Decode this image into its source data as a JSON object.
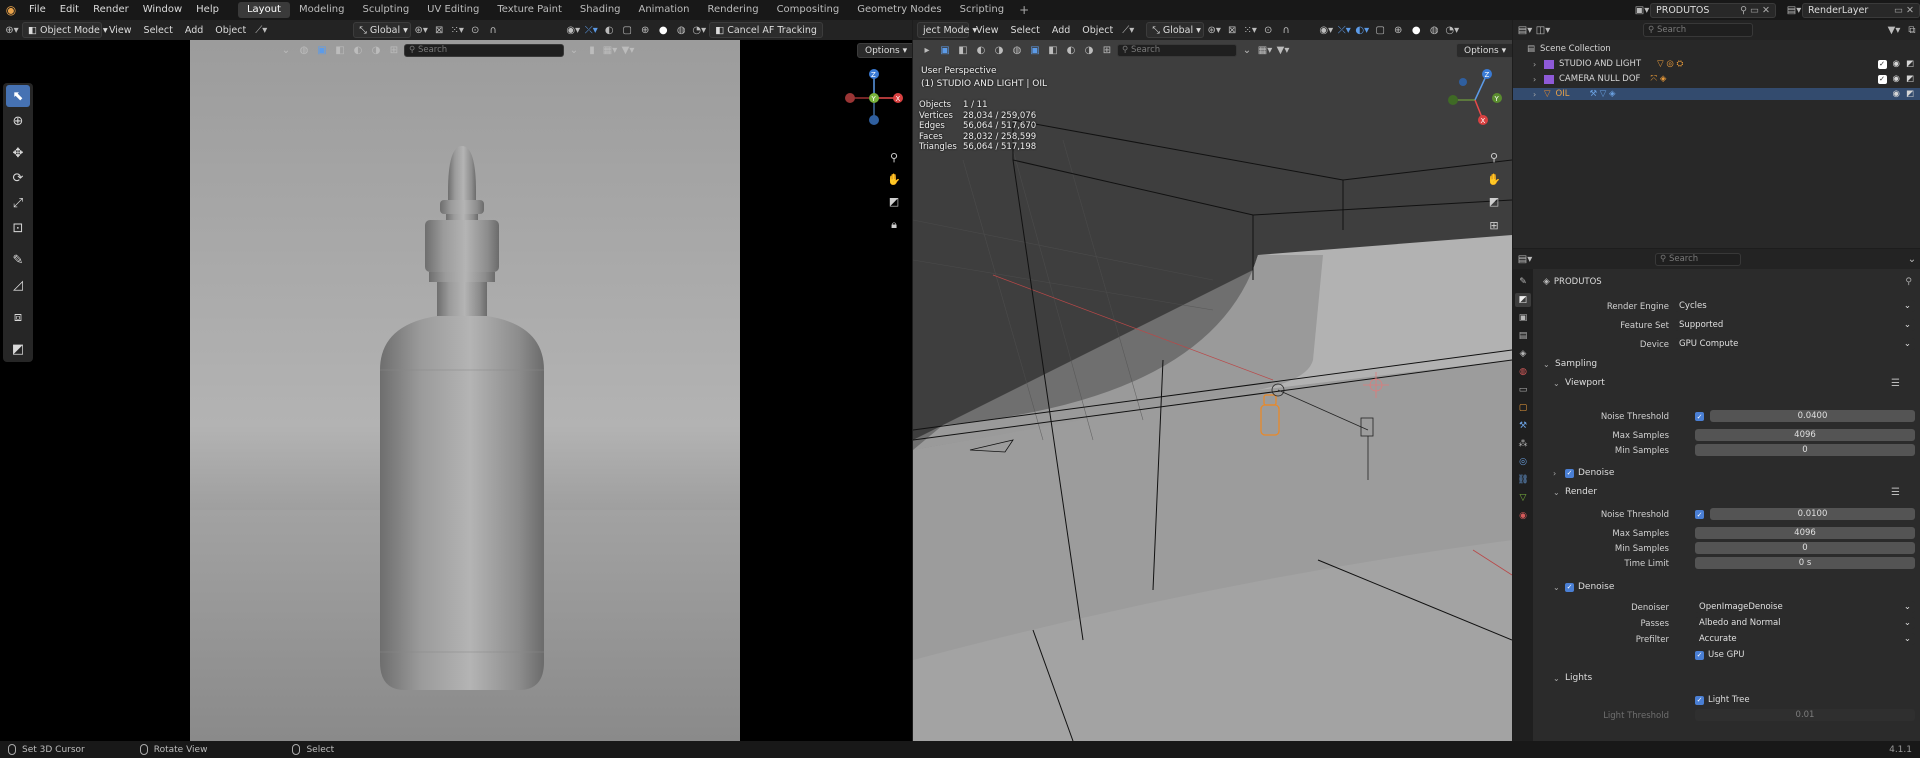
{
  "menu": [
    "File",
    "Edit",
    "Render",
    "Window",
    "Help"
  ],
  "workspaces": [
    "Layout",
    "Modeling",
    "Sculpting",
    "UV Editing",
    "Texture Paint",
    "Shading",
    "Animation",
    "Rendering",
    "Compositing",
    "Geometry Nodes",
    "Scripting"
  ],
  "active_workspace": "Layout",
  "scene_name": "PRODUTOS",
  "view_layer": "RenderLayer",
  "left_viewport": {
    "mode": "Object Mode",
    "menus": [
      "View",
      "Select",
      "Add",
      "Object"
    ],
    "transform": "Global",
    "cancel_af": "Cancel AF Tracking",
    "search_placeholder": "Search",
    "options": "Options"
  },
  "right_viewport": {
    "mode": "ject Mode",
    "menus": [
      "View",
      "Select",
      "Add",
      "Object"
    ],
    "transform": "Global",
    "search_placeholder": "Search",
    "options": "Options",
    "perspective": "User Perspective",
    "active_label": "(1) STUDIO AND LIGHT | OIL",
    "stats": [
      {
        "k": "Objects",
        "v": "1 / 11"
      },
      {
        "k": "Vertices",
        "v": "28,034 / 259,076"
      },
      {
        "k": "Edges",
        "v": "56,064 / 517,670"
      },
      {
        "k": "Faces",
        "v": "28,032 / 258,599"
      },
      {
        "k": "Triangles",
        "v": "56,064 / 517,198"
      }
    ]
  },
  "outliner": {
    "search_placeholder": "Search",
    "root": "Scene Collection",
    "items": [
      {
        "label": "STUDIO AND LIGHT"
      },
      {
        "label": "CAMERA NULL DOF"
      },
      {
        "label": "OIL"
      }
    ]
  },
  "properties": {
    "search_placeholder": "Search",
    "context": "PRODUTOS",
    "render_engine_label": "Render Engine",
    "render_engine": "Cycles",
    "feature_set_label": "Feature Set",
    "feature_set": "Supported",
    "device_label": "Device",
    "device": "GPU Compute",
    "sampling": "Sampling",
    "viewport": "Viewport",
    "vp_noise_label": "Noise Threshold",
    "vp_noise": "0.0400",
    "vp_max_label": "Max Samples",
    "vp_max": "4096",
    "vp_min_label": "Min Samples",
    "vp_min": "0",
    "vp_denoise": "Denoise",
    "render": "Render",
    "r_noise_label": "Noise Threshold",
    "r_noise": "0.0100",
    "r_max_label": "Max Samples",
    "r_max": "4096",
    "r_min_label": "Min Samples",
    "r_min": "0",
    "r_time_label": "Time Limit",
    "r_time": "0 s",
    "r_denoise": "Denoise",
    "denoiser_label": "Denoiser",
    "denoiser": "OpenImageDenoise",
    "passes_label": "Passes",
    "passes": "Albedo and Normal",
    "prefilter_label": "Prefilter",
    "prefilter": "Accurate",
    "use_gpu": "Use GPU",
    "lights": "Lights",
    "light_tree": "Light Tree",
    "light_threshold_label": "Light Threshold",
    "light_threshold": "0.01"
  },
  "status": {
    "left": "Set 3D Cursor",
    "middle": "Rotate View",
    "right": "Select",
    "version": "4.1.1"
  }
}
